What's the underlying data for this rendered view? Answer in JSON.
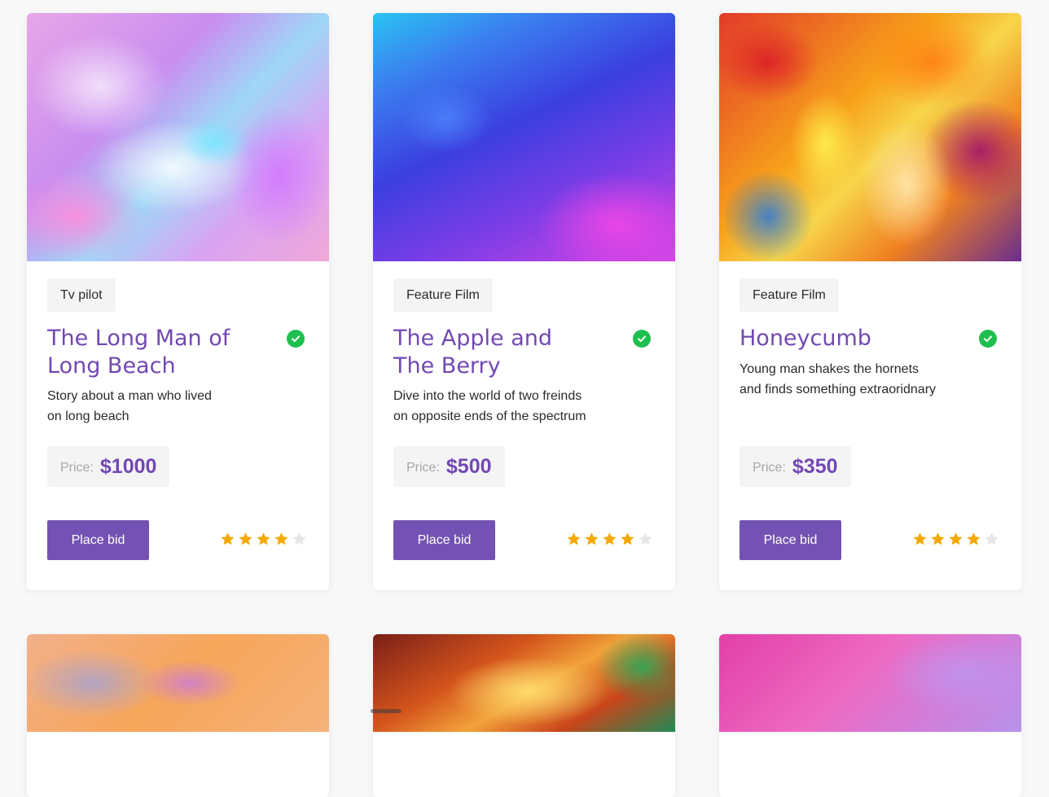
{
  "cards": [
    {
      "tag": "Tv pilot",
      "title": "The Long Man of\nLong Beach",
      "description": "Story about a man who lived\non long beach",
      "price_label": "Price:",
      "price": "$1000",
      "button": "Place bid",
      "rating": 4,
      "rating_max": 5,
      "verified_icon": "check-circle-icon",
      "art_colors": [
        "#e8a6e8",
        "#c98ef0",
        "#9fd7f7"
      ]
    },
    {
      "tag": "Feature Film",
      "title": "The Apple and\nThe Berry",
      "description": "Dive into the world of two freinds\non opposite ends of the spectrum",
      "price_label": "Price:",
      "price": "$500",
      "button": "Place bid",
      "rating": 4,
      "rating_max": 5,
      "verified_icon": "check-circle-icon",
      "art_colors": [
        "#29c4f2",
        "#3b3fe0",
        "#d445e6"
      ]
    },
    {
      "tag": "Feature Film",
      "title": "Honeycumb",
      "description": "Young man shakes the hornets\nand finds something extraoridnary",
      "price_label": "Price:",
      "price": "$350",
      "button": "Place bid",
      "rating": 4,
      "rating_max": 5,
      "verified_icon": "check-circle-icon",
      "art_colors": [
        "#e23a2a",
        "#f7a11a",
        "#6a2d8f"
      ]
    }
  ],
  "colors": {
    "accent": "#7248b3",
    "button": "#7452b3",
    "verified": "#1fbf4f",
    "star_filled": "#f5a800",
    "star_empty": "#e6e6e9",
    "chip_bg": "#f4f4f5"
  }
}
